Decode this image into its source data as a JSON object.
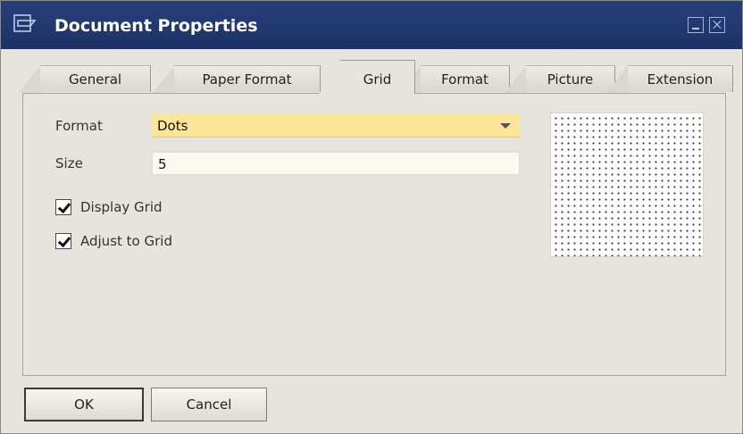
{
  "window": {
    "title": "Document Properties",
    "colors": {
      "titlebar": "#1f3a74",
      "body": "#e6e4dc",
      "format_field": "#fae696",
      "text_field": "#fbfaf1"
    }
  },
  "tabs": [
    {
      "label": "General",
      "active": false
    },
    {
      "label": "Paper Format",
      "active": false
    },
    {
      "label": "Grid",
      "active": true
    },
    {
      "label": "Format",
      "active": false
    },
    {
      "label": "Picture",
      "active": false
    },
    {
      "label": "Extension",
      "active": false
    }
  ],
  "grid": {
    "format_label": "Format",
    "format_value": "Dots",
    "size_label": "Size",
    "size_value": "5",
    "display_grid_label": "Display Grid",
    "display_grid_checked": true,
    "adjust_grid_label": "Adjust to Grid",
    "adjust_grid_checked": true
  },
  "buttons": {
    "ok": "OK",
    "cancel": "Cancel"
  }
}
